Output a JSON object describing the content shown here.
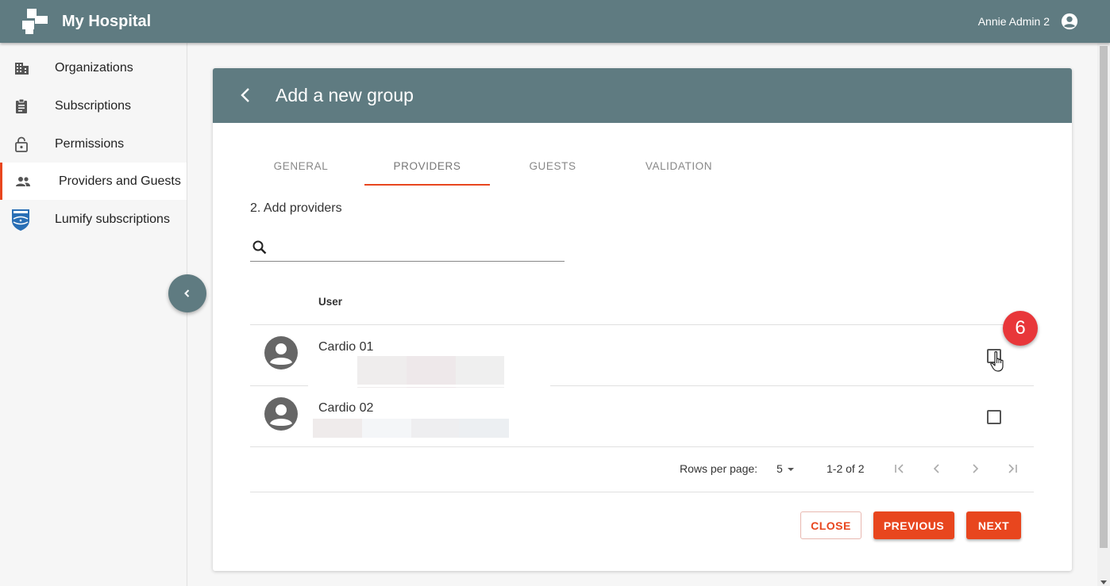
{
  "app": {
    "title": "My Hospital",
    "user_name": "Annie Admin 2"
  },
  "sidebar": {
    "items": [
      {
        "label": "Organizations",
        "icon": "building-icon"
      },
      {
        "label": "Subscriptions",
        "icon": "clipboard-icon"
      },
      {
        "label": "Permissions",
        "icon": "unlock-icon"
      },
      {
        "label": "Providers and Guests",
        "icon": "people-icon",
        "active": true
      },
      {
        "label": "Lumify subscriptions",
        "icon": "philips-shield-icon"
      }
    ]
  },
  "card": {
    "title": "Add a new group",
    "tabs": [
      {
        "label": "GENERAL"
      },
      {
        "label": "PROVIDERS",
        "active": true
      },
      {
        "label": "GUESTS"
      },
      {
        "label": "VALIDATION"
      }
    ],
    "step_label": "2. Add providers",
    "search": {
      "value": "",
      "placeholder": ""
    },
    "table": {
      "column_header": "User",
      "rows": [
        {
          "name": "Cardio 01",
          "checked": false
        },
        {
          "name": "Cardio 02",
          "checked": false
        }
      ]
    },
    "pagination": {
      "rows_per_page_label": "Rows per page:",
      "rows_per_page_value": "5",
      "range": "1-2 of 2"
    },
    "buttons": {
      "close": "CLOSE",
      "previous": "PREVIOUS",
      "next": "NEXT"
    }
  },
  "annotation": {
    "step_number": "6"
  },
  "colors": {
    "header": "#5f7b81",
    "accent": "#e8461e",
    "badge": "#e8373a"
  }
}
